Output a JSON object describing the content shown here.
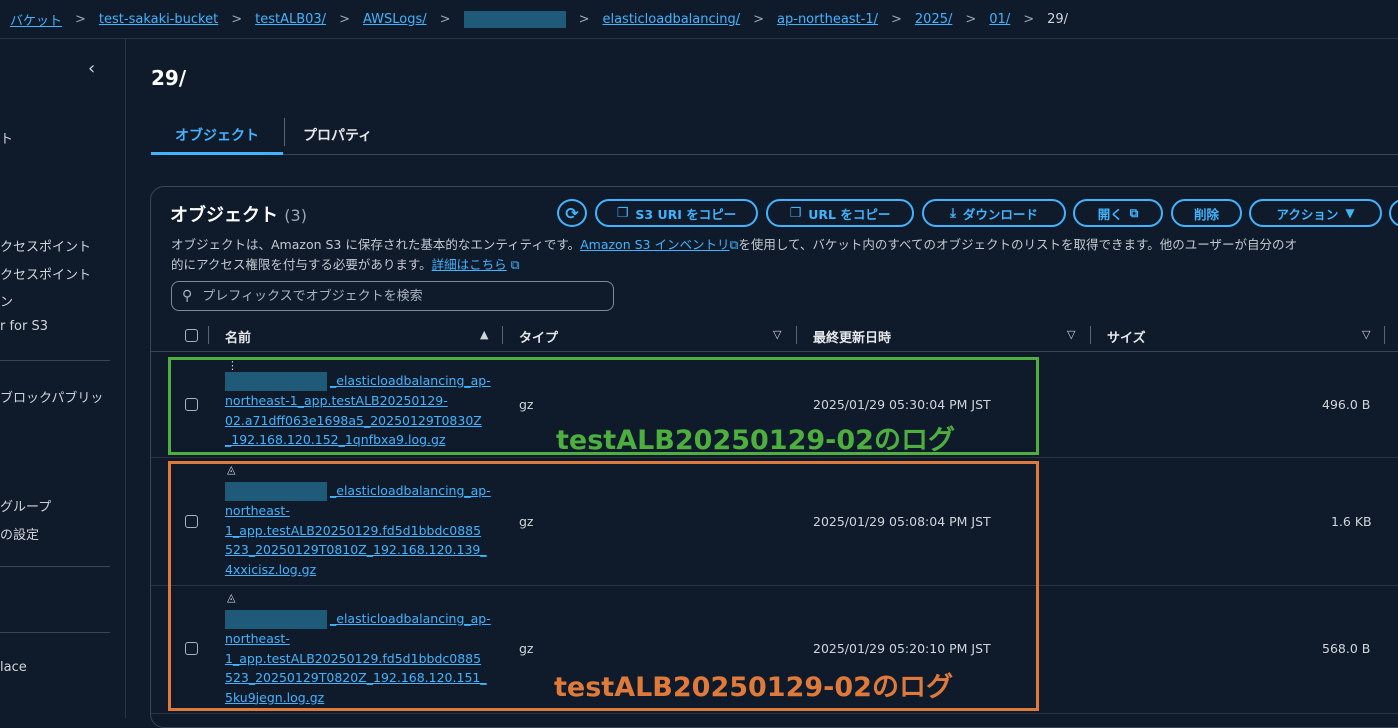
{
  "breadcrumb": {
    "items": [
      {
        "label": "バケット"
      },
      {
        "label": "test-sakaki-bucket"
      },
      {
        "label": "testALB03/"
      },
      {
        "label": "AWSLogs/"
      },
      {
        "label": "elasticloadbalancing/"
      },
      {
        "label": "ap-northeast-1/"
      },
      {
        "label": "2025/"
      },
      {
        "label": "01/"
      }
    ],
    "current": "29/"
  },
  "sidebar": {
    "items": [
      "ト",
      "クセスポイント",
      "クセスポイント",
      "ン",
      "r for S3",
      "ブロックパブリッ",
      "グループ",
      "の設定",
      "lace"
    ]
  },
  "page": {
    "title": "29/"
  },
  "tabs": {
    "objects": "オブジェクト",
    "properties": "プロパティ"
  },
  "panel": {
    "title": "オブジェクト",
    "count": "(3)",
    "desc_part1": "オブジェクトは、Amazon S3 に保存された基本的なエンティティです。",
    "desc_link1": "Amazon S3 インベントリ",
    "desc_part2": "を使用して、バケット内のすべてのオブジェクトのリストを取得できます。他のユーザーが自分のオ",
    "desc_line2": "的にアクセス権限を付与する必要があります。",
    "desc_link2": "詳細はこちら"
  },
  "toolbar": {
    "copy_s3_uri": "S3 URI をコピー",
    "copy_url": "URL をコピー",
    "download": "ダウンロード",
    "open": "開く",
    "delete": "削除",
    "actions": "アクション"
  },
  "search": {
    "placeholder": "プレフィックスでオブジェクトを検索"
  },
  "table": {
    "headers": {
      "name": "名前",
      "type": "タイプ",
      "modified": "最終更新日時",
      "size": "サイズ"
    },
    "rows": [
      {
        "name_lines": [
          "_elasticloadbalancing_ap-",
          "northeast-1_app.testALB20250129-",
          "02.a71dff063e1698a5_20250129T0830Z",
          "_192.168.120.152_1qnfbxa9.log.gz"
        ],
        "type": "gz",
        "modified": "2025/01/29 05:30:04 PM JST",
        "size": "496.0 B"
      },
      {
        "name_lines": [
          "_elasticloadbalancing_ap-",
          "northeast-",
          "1_app.testALB20250129.fd5d1bbdc0885",
          "523_20250129T0810Z_192.168.120.139_",
          "4xxicisz.log.gz"
        ],
        "type": "gz",
        "modified": "2025/01/29 05:08:04 PM JST",
        "size": "1.6 KB"
      },
      {
        "name_lines": [
          "_elasticloadbalancing_ap-",
          "northeast-",
          "1_app.testALB20250129.fd5d1bbdc0885",
          "523_20250129T0820Z_192.168.120.151_",
          "5ku9jegn.log.gz"
        ],
        "type": "gz",
        "modified": "2025/01/29 05:20:10 PM JST",
        "size": "568.0 B"
      }
    ]
  },
  "annotations": {
    "green": "testALB20250129-02のログ",
    "orange": "testALB20250129-02のログ"
  },
  "colors": {
    "accent": "#42b4ff",
    "green": "#4caf3e",
    "orange": "#e07a3a",
    "background": "#0f1b2a"
  }
}
